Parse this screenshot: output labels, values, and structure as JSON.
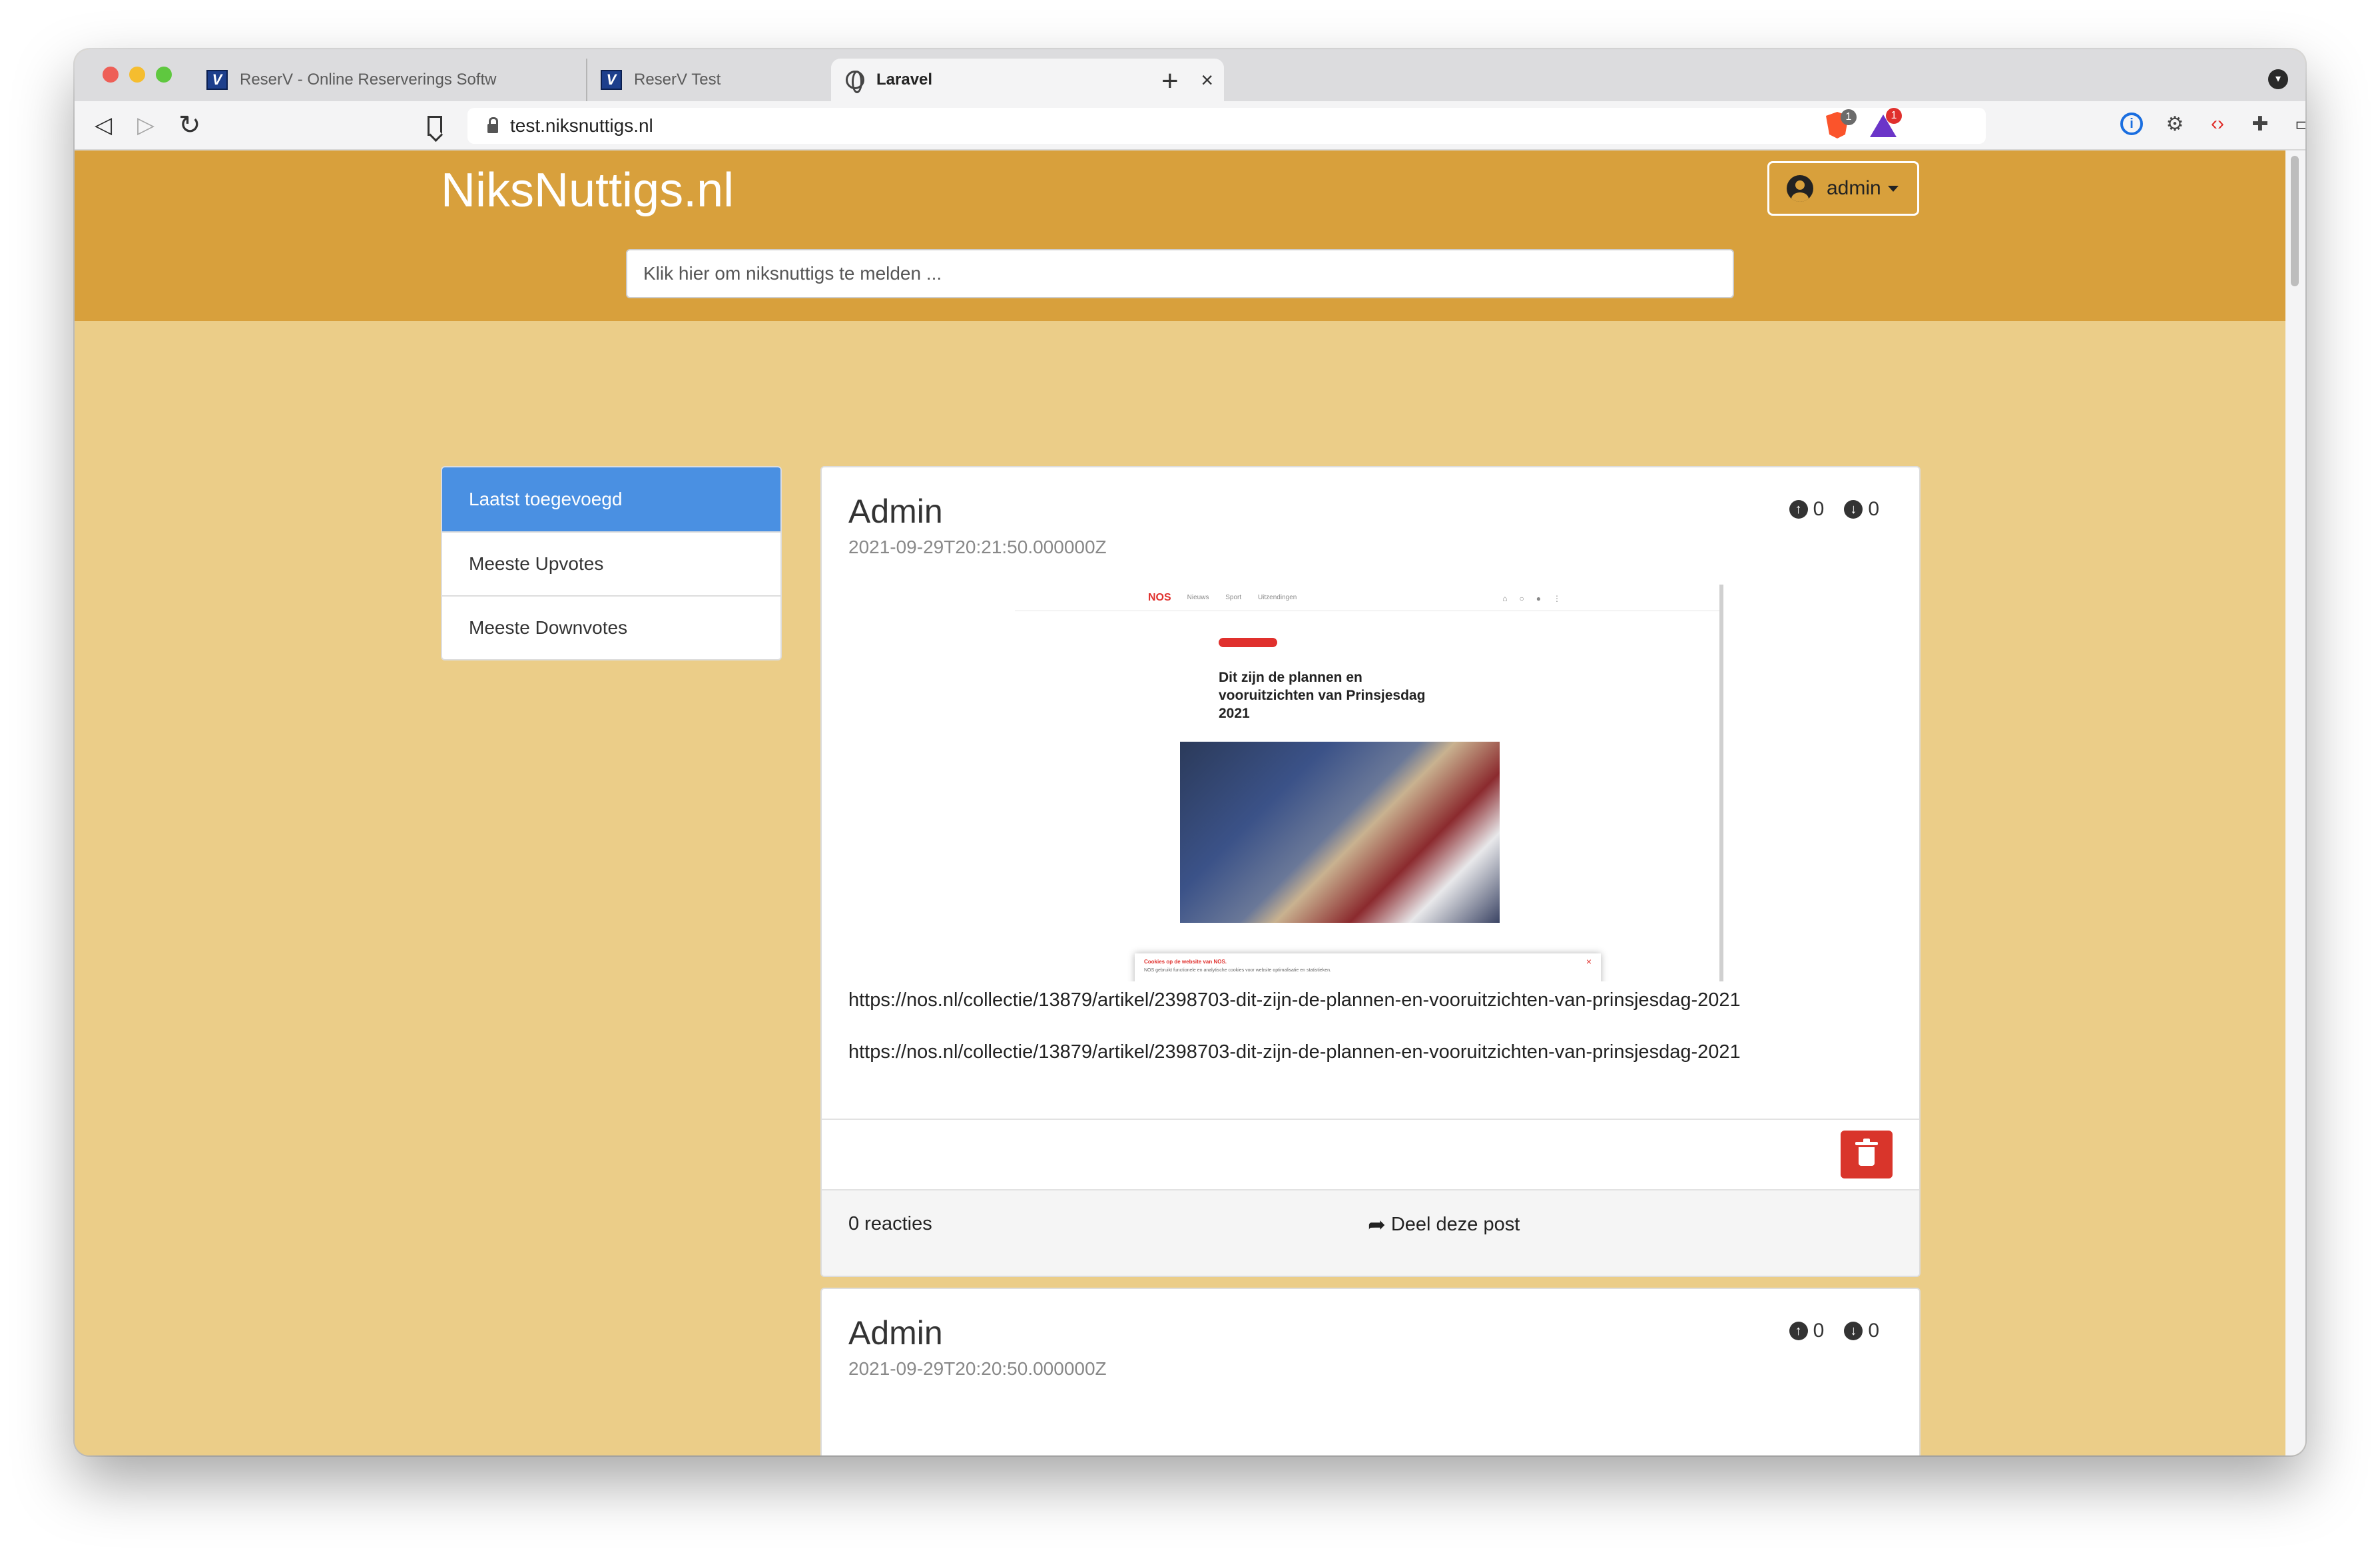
{
  "browser": {
    "tabs": [
      {
        "title": "ReserV - Online Reserverings Softw",
        "icon": "reserv-icon"
      },
      {
        "title": "ReserV Test",
        "icon": "reserv-icon"
      },
      {
        "title": "Laravel",
        "icon": "globe-icon",
        "active": true
      }
    ],
    "close_glyph": "×",
    "new_tab_glyph": "+",
    "url": "test.niksnuttigs.nl",
    "brave_badge": "1",
    "rewards_badge": "1"
  },
  "site": {
    "brand": "NiksNuttigs.nl",
    "user_menu_label": "admin",
    "search_placeholder": "Klik hier om niksnuttigs te melden ..."
  },
  "sidebar": {
    "items": [
      {
        "label": "Laatst toegevoegd",
        "active": true
      },
      {
        "label": "Meeste Upvotes"
      },
      {
        "label": "Meeste Downvotes"
      }
    ]
  },
  "posts": [
    {
      "author": "Admin",
      "date": "2021-09-29T20:21:50.000000Z",
      "upvotes": "0",
      "downvotes": "0",
      "image": {
        "logo": "NOS",
        "nav": [
          "Nieuws",
          "Sport",
          "Uitzendingen"
        ],
        "headline": "Dit zijn de plannen en vooruitzichten van Prinsjesdag 2021",
        "cookie_title": "Cookies op de website van NOS.",
        "cookie_text": "NOS gebruikt functionele en analytische cookies voor website optimalisatie en statistieken."
      },
      "links": [
        "https://nos.nl/collectie/13879/artikel/2398703-dit-zijn-de-plannen-en-vooruitzichten-van-prinsjesdag-2021",
        "https://nos.nl/collectie/13879/artikel/2398703-dit-zijn-de-plannen-en-vooruitzichten-van-prinsjesdag-2021"
      ],
      "reactions": "0 reacties",
      "share_label": "Deel deze post"
    },
    {
      "author": "Admin",
      "date": "2021-09-29T20:20:50.000000Z",
      "upvotes": "0",
      "downvotes": "0"
    }
  ],
  "colors": {
    "navbar": "#d8a03c",
    "page_bg": "#ebcd88",
    "active_item": "#4a90e2",
    "delete": "#d9352b"
  }
}
